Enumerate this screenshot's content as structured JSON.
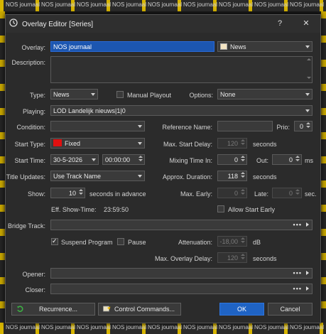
{
  "dialog": {
    "title": "Overlay Editor [Series]",
    "help": "?",
    "close": "✕"
  },
  "overlay": {
    "label": "Overlay:",
    "value": "NOS journaal",
    "category": "News",
    "category_color": "#f3e4c3"
  },
  "description": {
    "label": "Description:",
    "value": ""
  },
  "type": {
    "label": "Type:",
    "value": "News",
    "manual_playout": "Manual Playout",
    "options_label": "Options:",
    "options_value": "None"
  },
  "playing": {
    "label": "Playing:",
    "value": "LOD Landelijk nieuws|1|0"
  },
  "condition": {
    "label": "Condition:",
    "value": ""
  },
  "reference": {
    "label": "Reference Name:",
    "value": "",
    "prio_label": "Prio:",
    "prio_value": "0"
  },
  "start_type": {
    "label": "Start Type:",
    "value": "Fixed",
    "swatch_color": "#e01010"
  },
  "max_start_delay": {
    "label": "Max. Start Delay:",
    "value": "120",
    "unit": "seconds"
  },
  "start_time": {
    "label": "Start Time:",
    "date": "30-5-2026",
    "time": "00:00:00"
  },
  "mixing_time": {
    "label": "Mixing Time In:",
    "value": "0",
    "out_label": "Out:",
    "out_value": "0",
    "unit": "ms"
  },
  "title_updates": {
    "label": "Title Updates:",
    "value": "Use Track Name"
  },
  "approx_duration": {
    "label": "Approx. Duration:",
    "value": "118",
    "unit": "seconds"
  },
  "show": {
    "label": "Show:",
    "value": "10",
    "unit": "seconds in advance"
  },
  "max_early": {
    "label": "Max. Early:",
    "value": "0",
    "late_label": "Late:",
    "late_value": "0",
    "unit": "sec."
  },
  "eff_show_time": {
    "label": "Eff. Show-Time:",
    "value": "23:59:50"
  },
  "allow_start_early": {
    "label": "Allow Start Early"
  },
  "bridge_track": {
    "label": "Bridge Track:",
    "value": "",
    "dots": "•••"
  },
  "suspend_program": {
    "label": "Suspend Program",
    "checked": true
  },
  "pause": {
    "label": "Pause",
    "checked": false
  },
  "attenuation": {
    "label": "Attenuation:",
    "value": "-18,00",
    "unit": "dB"
  },
  "max_overlay_delay": {
    "label": "Max. Overlay Delay:",
    "value": "120",
    "unit": "seconds"
  },
  "opener": {
    "label": "Opener:",
    "value": "",
    "dots": "•••"
  },
  "closer": {
    "label": "Closer:",
    "value": "",
    "dots": "•••"
  },
  "buttons": {
    "recurrence": "Recurrence...",
    "control_commands": "Control Commands...",
    "ok": "OK",
    "cancel": "Cancel"
  },
  "background": {
    "top": [
      "NOS journaal",
      "NOS journaal",
      "NOS journaal",
      "NOS journaal",
      "NOS journaal",
      "NOS journaal",
      "NOS journaal",
      "NOS journaal",
      "NOS journaal"
    ],
    "bottom": [
      "NOS journaal",
      "NOS journaal",
      "NOS journaal",
      "NOS journaal",
      "NOS journaal",
      "NOS journaal",
      "NOS journaal",
      "NOS journaal",
      "NOS journaal"
    ]
  }
}
